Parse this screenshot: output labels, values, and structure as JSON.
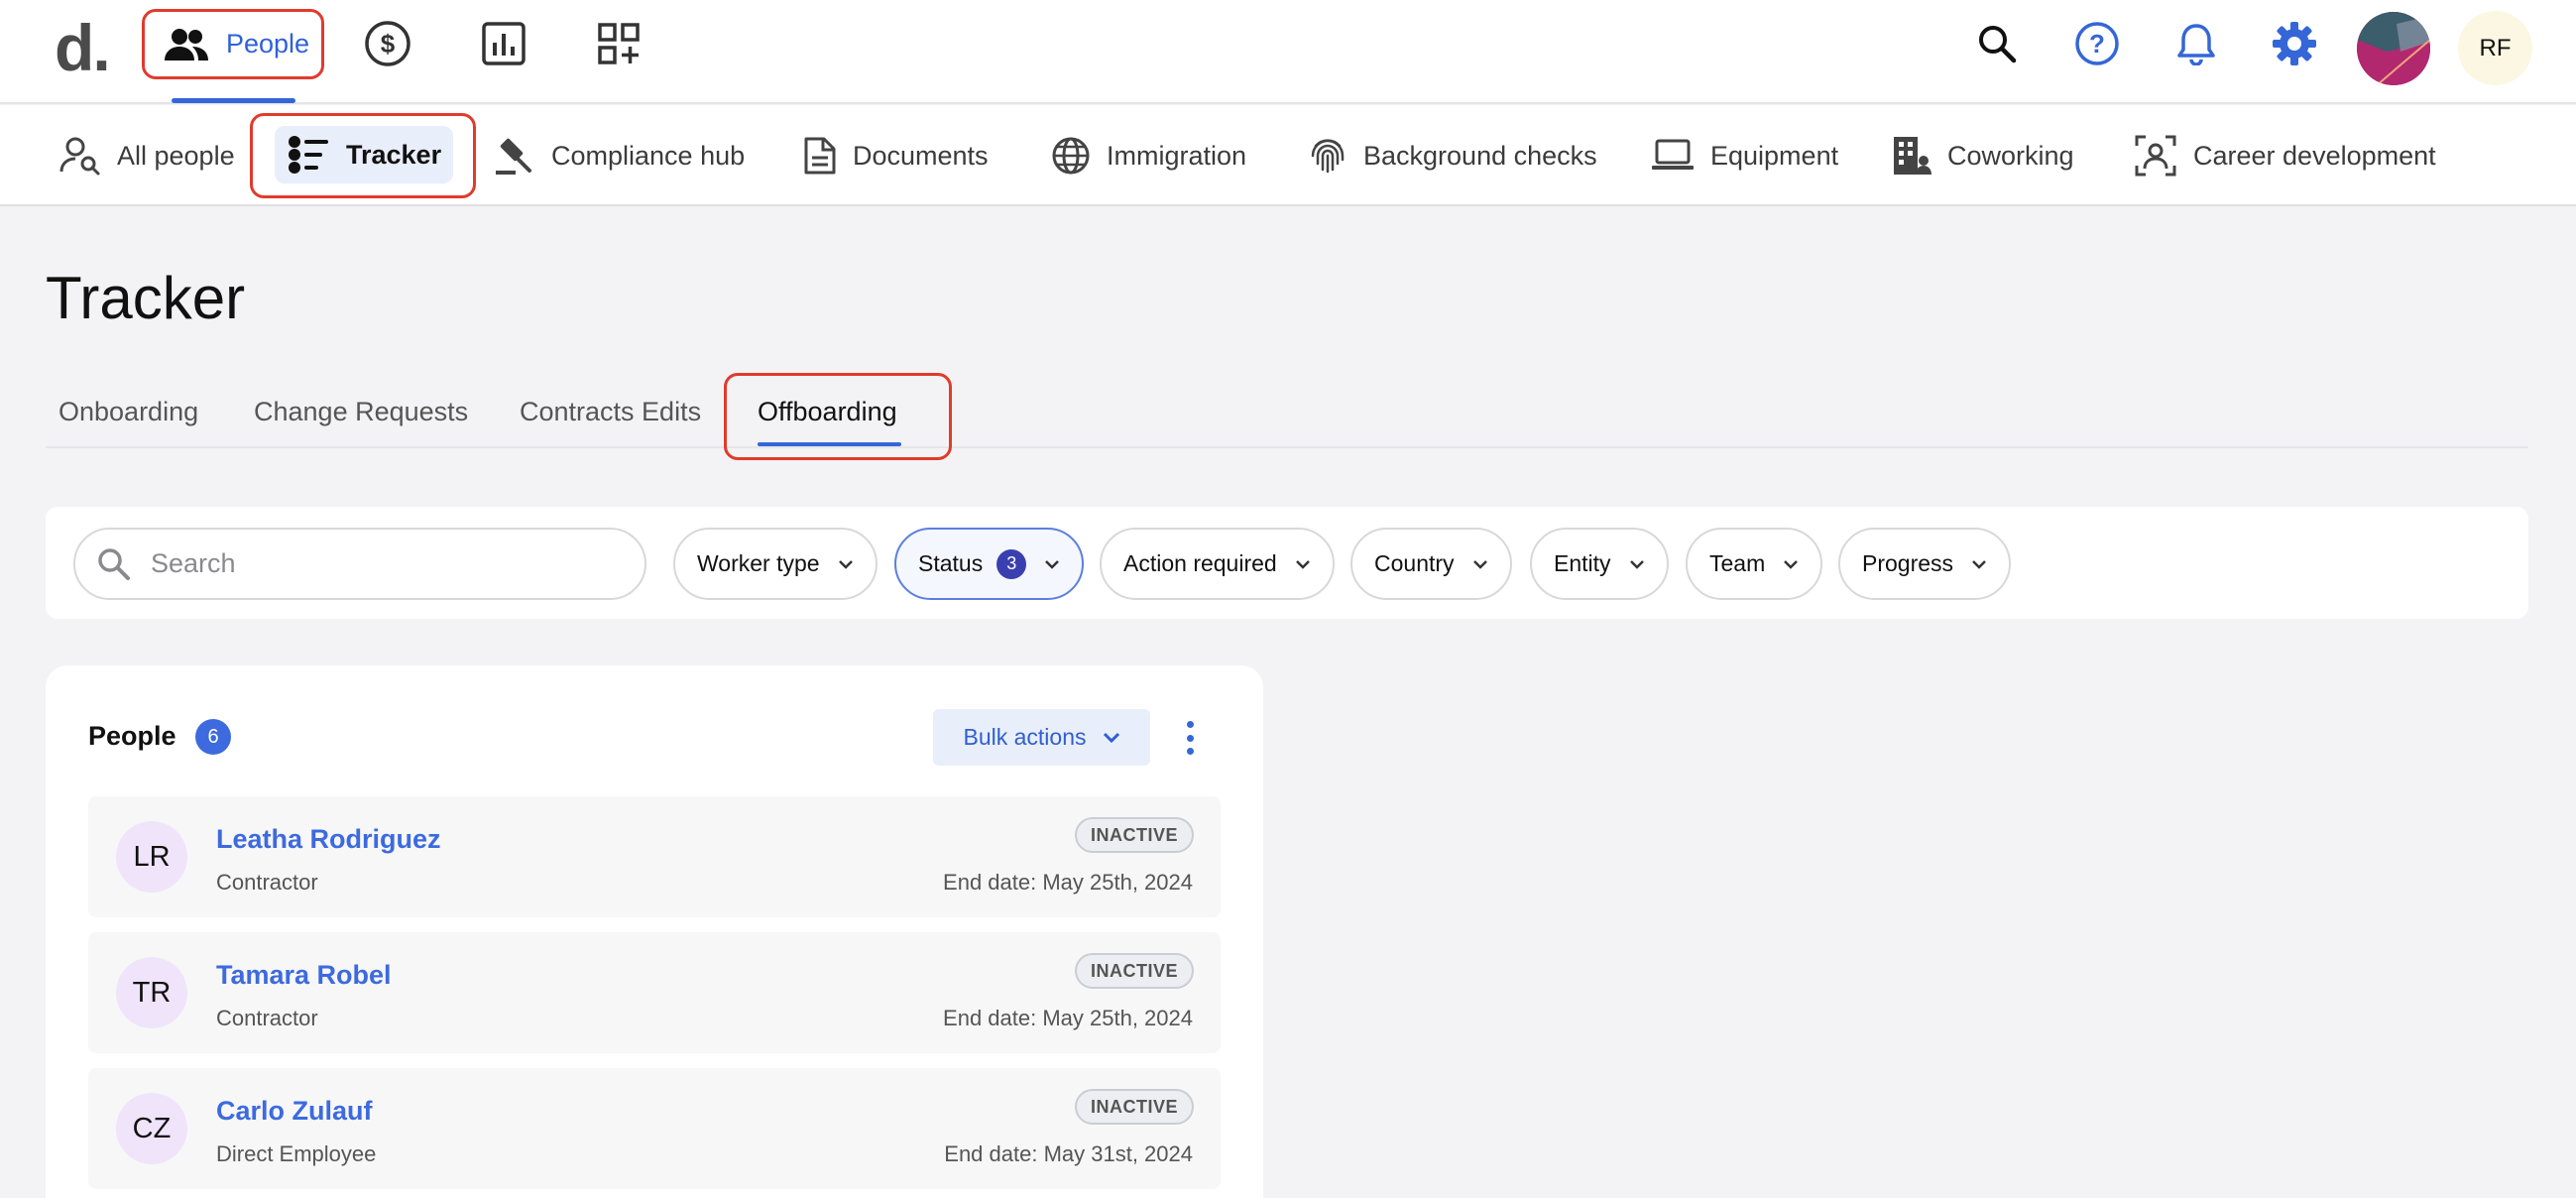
{
  "topbar": {
    "logo_letter": "d",
    "logo_dot": ".",
    "people_label": "People",
    "icons": [
      "people-icon",
      "dollar-icon",
      "reports-icon",
      "apps-icon",
      "search-icon",
      "help-icon",
      "bell-icon",
      "gear-icon"
    ],
    "user_initials": "RF"
  },
  "subnav": {
    "items": [
      {
        "label": "All people",
        "icon": "user-search-icon"
      },
      {
        "label": "Tracker",
        "icon": "tracker-icon"
      },
      {
        "label": "Compliance hub",
        "icon": "gavel-icon"
      },
      {
        "label": "Documents",
        "icon": "document-icon"
      },
      {
        "label": "Immigration",
        "icon": "globe-icon"
      },
      {
        "label": "Background checks",
        "icon": "fingerprint-icon"
      },
      {
        "label": "Equipment",
        "icon": "laptop-icon"
      },
      {
        "label": "Coworking",
        "icon": "building-icon"
      },
      {
        "label": "Career development",
        "icon": "career-icon"
      }
    ]
  },
  "page": {
    "title": "Tracker",
    "tabs": [
      "Onboarding",
      "Change Requests",
      "Contracts Edits",
      "Offboarding"
    ],
    "active_tab": "Offboarding"
  },
  "filters": {
    "search_placeholder": "Search",
    "buttons": [
      {
        "label": "Worker type"
      },
      {
        "label": "Status",
        "count": "3"
      },
      {
        "label": "Action required"
      },
      {
        "label": "Country"
      },
      {
        "label": "Entity"
      },
      {
        "label": "Team"
      },
      {
        "label": "Progress"
      }
    ]
  },
  "people": {
    "title": "People",
    "count": "6",
    "bulk_actions_label": "Bulk actions",
    "rows": [
      {
        "initials": "LR",
        "name": "Leatha Rodriguez",
        "role": "Contractor",
        "status": "INACTIVE",
        "end_date": "End date: May 25th, 2024"
      },
      {
        "initials": "TR",
        "name": "Tamara Robel",
        "role": "Contractor",
        "status": "INACTIVE",
        "end_date": "End date: May 25th, 2024"
      },
      {
        "initials": "CZ",
        "name": "Carlo Zulauf",
        "role": "Direct Employee",
        "status": "INACTIVE",
        "end_date": "End date: May 31st, 2024"
      }
    ]
  },
  "colors": {
    "accent": "#3566d8",
    "highlight_outline": "#e03b2c",
    "status_badge": "#3a3fb0"
  }
}
